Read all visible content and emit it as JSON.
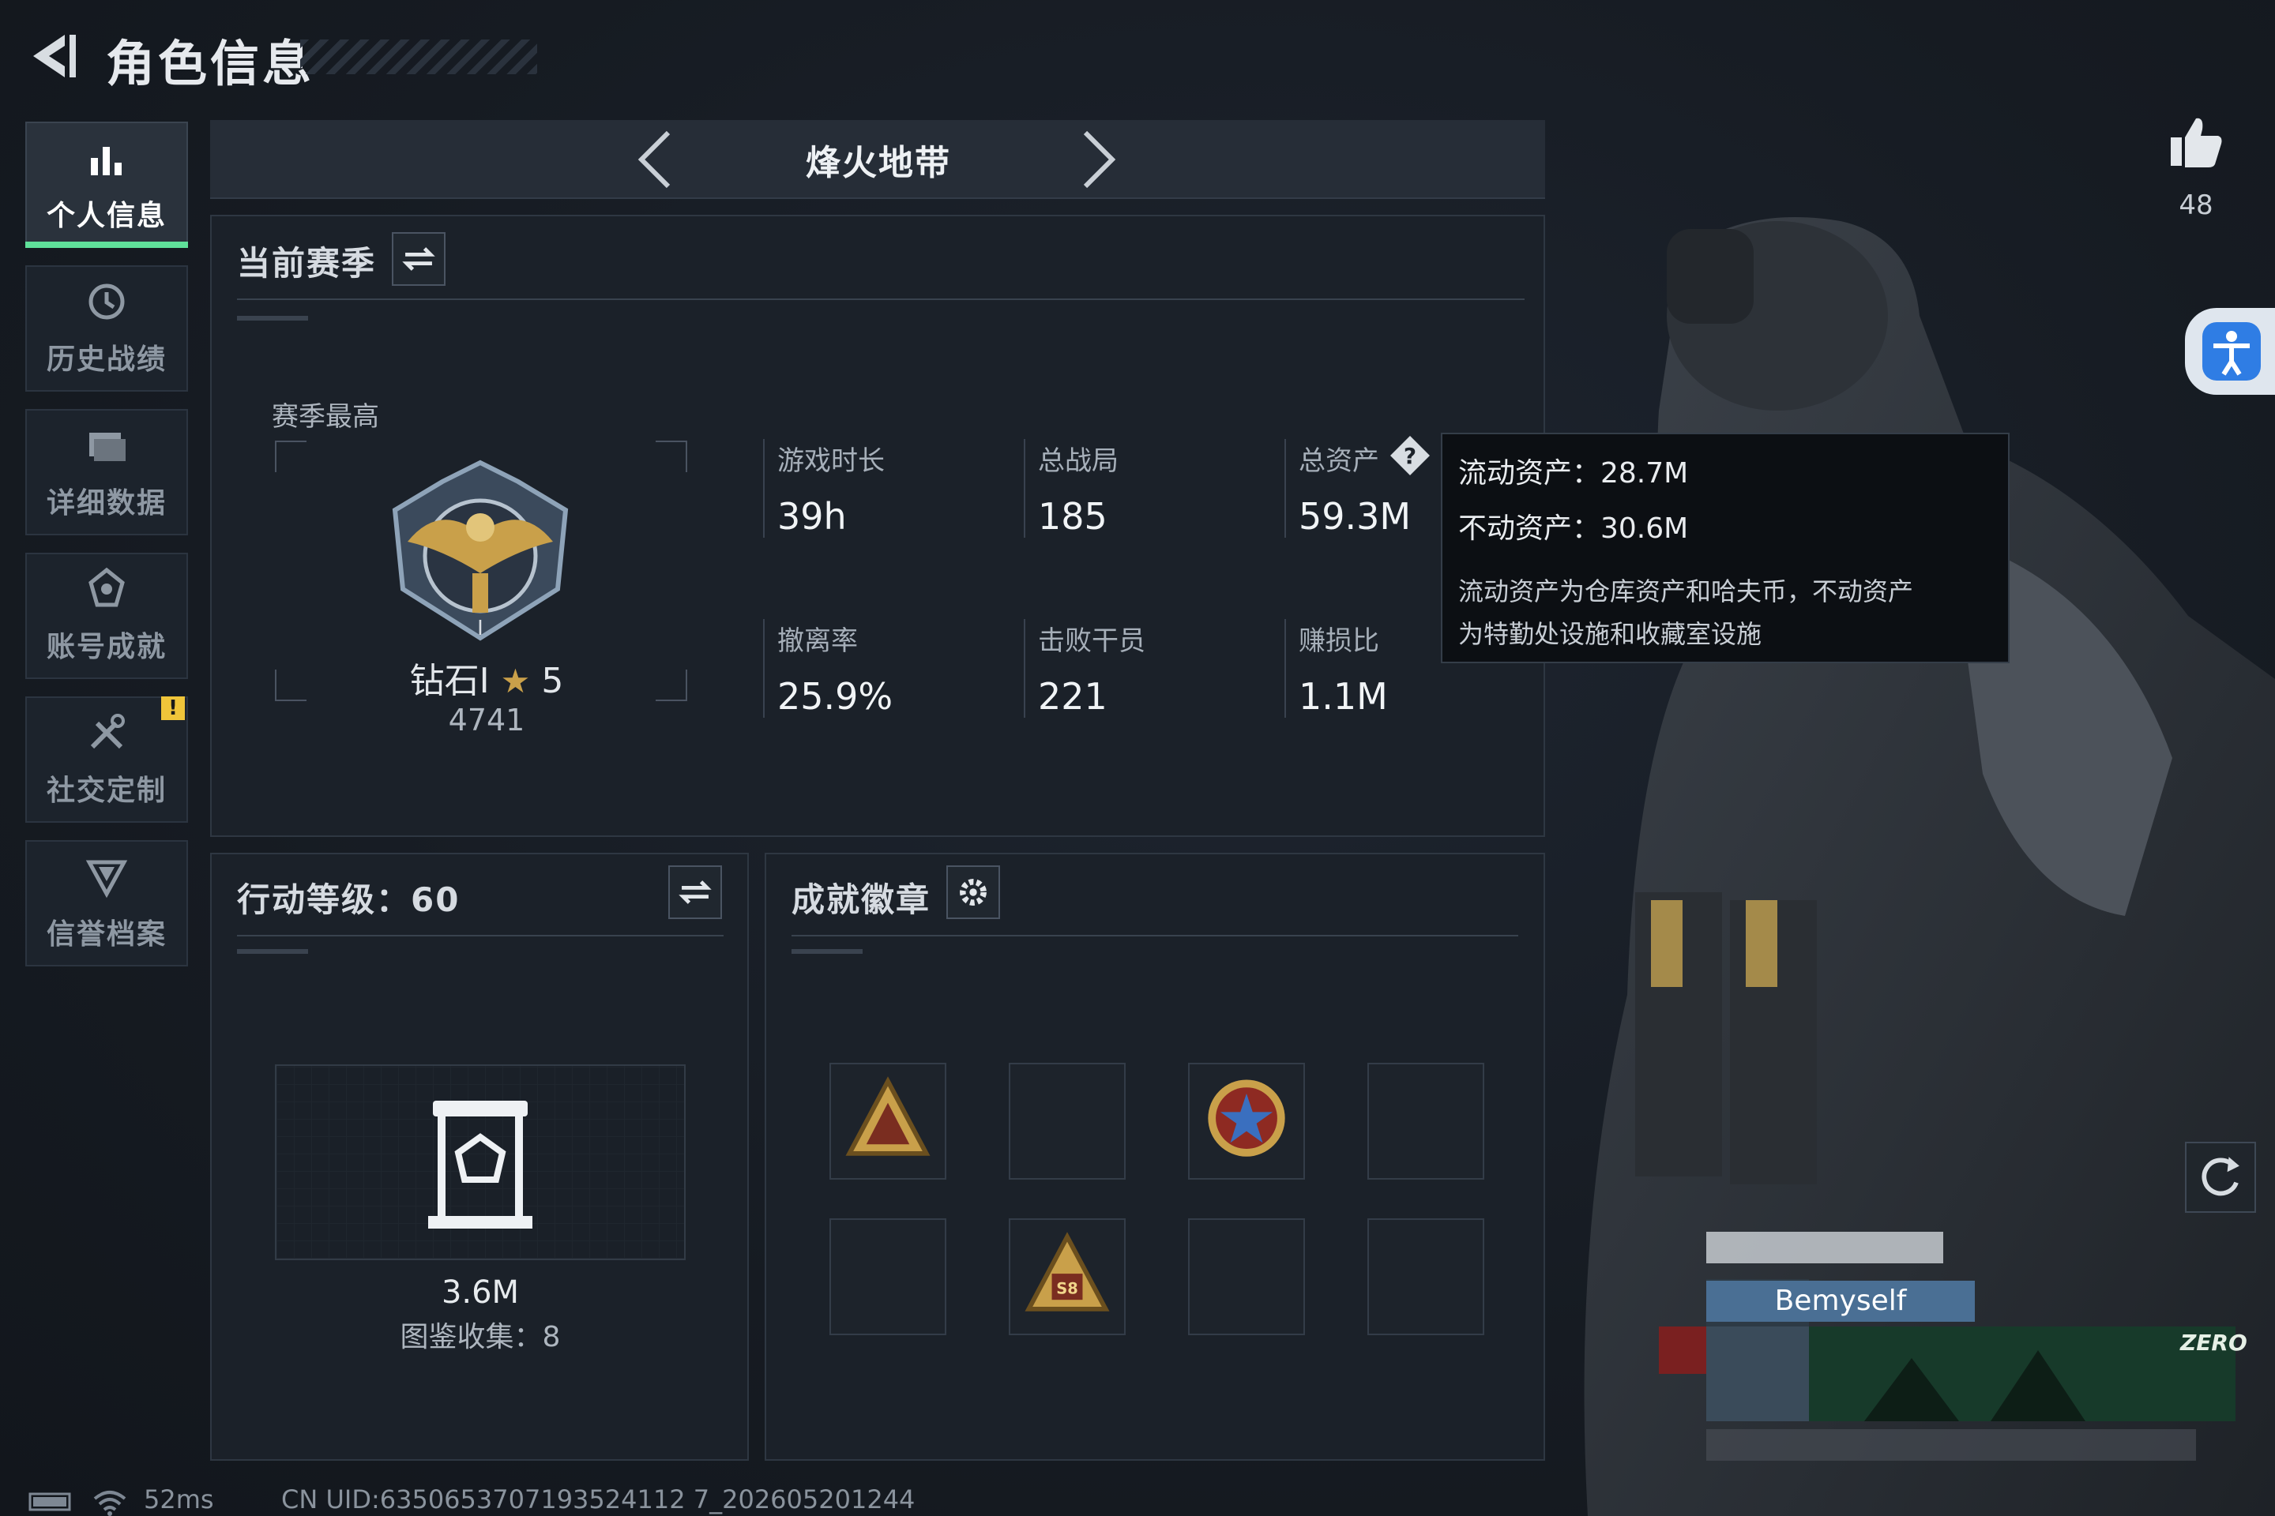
{
  "header": {
    "title": "角色信息"
  },
  "sidebar": {
    "items": [
      {
        "label": "个人信息",
        "icon": "bar-chart-icon",
        "active": true
      },
      {
        "label": "历史战绩",
        "icon": "clock-history-icon"
      },
      {
        "label": "详细数据",
        "icon": "folder-icon"
      },
      {
        "label": "账号成就",
        "icon": "achievement-icon"
      },
      {
        "label": "社交定制",
        "icon": "tools-icon",
        "badge": "!"
      },
      {
        "label": "信誉档案",
        "icon": "reputation-icon"
      }
    ]
  },
  "mode": {
    "title": "烽火地带"
  },
  "season": {
    "title": "当前赛季",
    "best_label": "赛季最高",
    "rank_name": "钻石I",
    "rank_stars": "5",
    "rank_score": "4741",
    "stats": [
      {
        "label": "游戏时长",
        "value": "39h"
      },
      {
        "label": "总战局",
        "value": "185"
      },
      {
        "label": "总资产",
        "value": "59.3M"
      },
      {
        "label": "撤离率",
        "value": "25.9%"
      },
      {
        "label": "击败干员",
        "value": "221"
      },
      {
        "label": "赚损比",
        "value": "1.1M"
      }
    ]
  },
  "tooltip": {
    "liquid": "流动资产：28.7M",
    "fixed": "不动资产：30.6M",
    "note_line1": "流动资产为仓库资产和哈夫币，不动资产",
    "note_line2": "为特勤处设施和收藏室设施"
  },
  "action": {
    "title": "行动等级：60",
    "collection_value": "3.6M",
    "collection_count": "图鉴收集：8"
  },
  "badges": {
    "title": "成就徽章",
    "slots": [
      {
        "filled": true,
        "icon": "triangle-team-badge-icon"
      },
      {
        "filled": false
      },
      {
        "filled": true,
        "icon": "star-medal-badge-icon"
      },
      {
        "filled": false
      },
      {
        "filled": false
      },
      {
        "filled": true,
        "icon": "triangle-s8-badge-icon",
        "text": "S8"
      },
      {
        "filled": false
      },
      {
        "filled": false
      }
    ]
  },
  "likes": {
    "count": "48"
  },
  "player": {
    "name": "Bemyself",
    "banner_text": "ZERO"
  },
  "status": {
    "ping": "52ms",
    "uid": "CN UID:6350653707193524112 7_202605201244"
  },
  "colors": {
    "accent_green": "#5fe09a",
    "warning": "#f0c53a",
    "name_bg": "#4a6f94"
  }
}
